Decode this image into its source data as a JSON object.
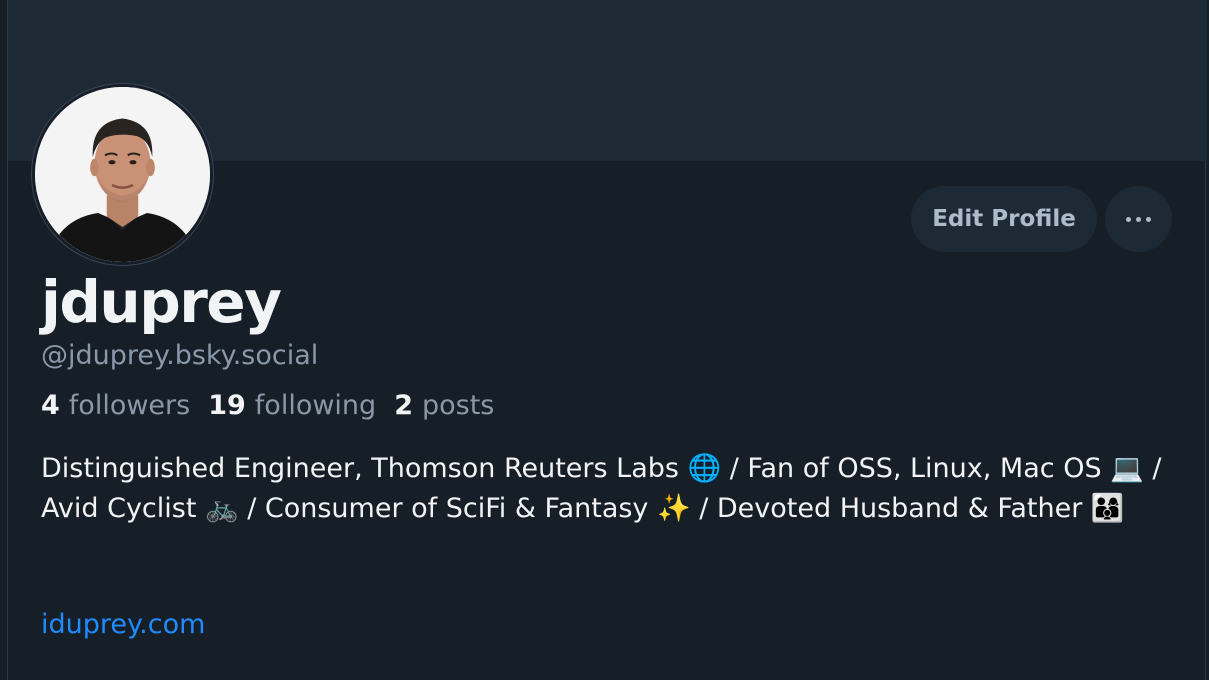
{
  "profile": {
    "display_name": "jduprey",
    "handle": "@jduprey.bsky.social",
    "bio": "Distinguished Engineer, Thomson Reuters Labs 🌐 / Fan of OSS, Linux, Mac OS 💻 / Avid Cyclist 🚲 / Consumer of SciFi & Fantasy ✨ / Devoted Husband & Father 👨‍👩‍👦",
    "website": "iduprey.com"
  },
  "stats": {
    "followers_count": "4",
    "followers_label": "followers",
    "following_count": "19",
    "following_label": "following",
    "posts_count": "2",
    "posts_label": "posts"
  },
  "actions": {
    "edit_profile_label": "Edit Profile",
    "more_icon": "more-horizontal-icon"
  },
  "colors": {
    "background": "#161e27",
    "banner": "#1e2936",
    "button_bg": "#1e2936",
    "primary_text": "#f1f3f5",
    "secondary_text": "#8a98a8",
    "link": "#208bfe"
  }
}
